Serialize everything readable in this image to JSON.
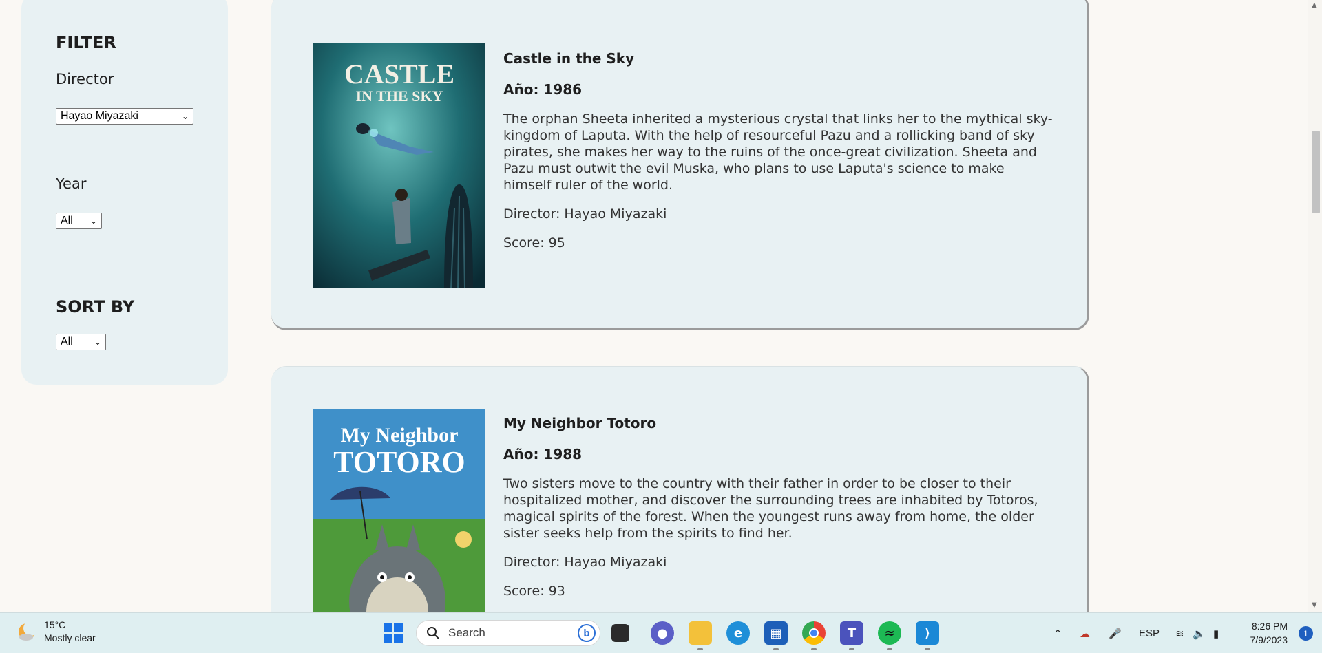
{
  "sidebar": {
    "filter_heading": "FILTER",
    "director_label": "Director",
    "director_selected": "Hayao Miyazaki",
    "year_label": "Year",
    "year_selected": "All",
    "sort_heading": "SORT BY",
    "sort_selected": "All"
  },
  "movies": [
    {
      "title": "Castle in the Sky",
      "year": "Año: 1986",
      "description": "The orphan Sheeta inherited a mysterious crystal that links her to the mythical sky-kingdom of Laputa. With the help of resourceful Pazu and a rollicking band of sky pirates, she makes her way to the ruins of the once-great civilization. Sheeta and Pazu must outwit the evil Muska, who plans to use Laputa's science to make himself ruler of the world.",
      "director": "Director: Hayao Miyazaki",
      "score": "Score: 95",
      "poster_line1": "CASTLE",
      "poster_line2": "IN THE SKY"
    },
    {
      "title": "My Neighbor Totoro",
      "year": "Año: 1988",
      "description": "Two sisters move to the country with their father in order to be closer to their hospitalized mother, and discover the surrounding trees are inhabited by Totoros, magical spirits of the forest. When the youngest runs away from home, the older sister seeks help from the spirits to find her.",
      "director": "Director: Hayao Miyazaki",
      "score": "Score: 93",
      "poster_line1": "My Neighbor",
      "poster_line2": "TOTORO"
    }
  ],
  "taskbar": {
    "temperature": "15°C",
    "weather": "Mostly clear",
    "search_placeholder": "Search",
    "language": "ESP",
    "time": "8:26 PM",
    "date": "7/9/2023",
    "notification_count": "1",
    "icons": [
      "start-icon",
      "task-view-icon",
      "teams-chat-icon",
      "file-explorer-icon",
      "edge-icon",
      "store-icon",
      "chrome-icon",
      "teams-icon",
      "spotify-icon",
      "vscode-icon"
    ]
  }
}
